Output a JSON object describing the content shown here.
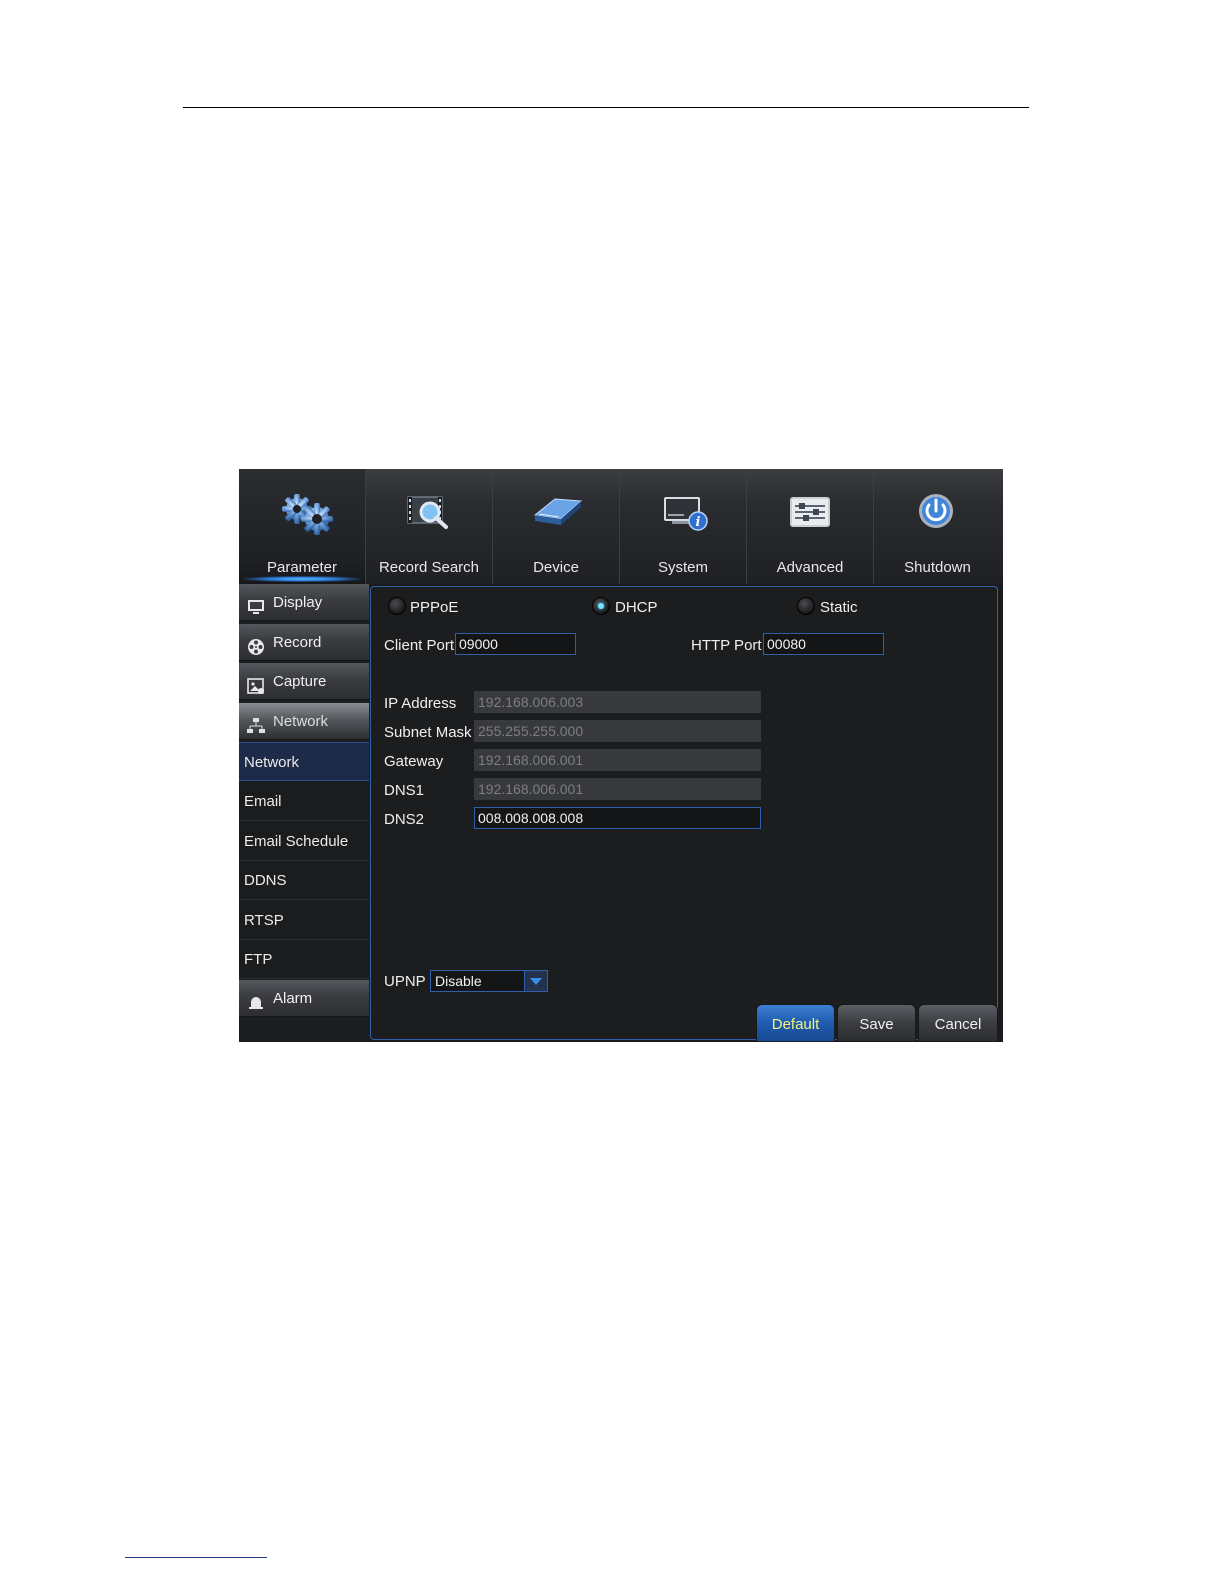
{
  "tabs": [
    {
      "label": "Parameter",
      "icon": "gears-icon"
    },
    {
      "label": "Record Search",
      "icon": "film-search-icon"
    },
    {
      "label": "Device",
      "icon": "hard-drive-icon"
    },
    {
      "label": "System",
      "icon": "monitor-info-icon"
    },
    {
      "label": "Advanced",
      "icon": "sliders-icon"
    },
    {
      "label": "Shutdown",
      "icon": "power-icon"
    }
  ],
  "sidebar": {
    "display": "Display",
    "record": "Record",
    "capture": "Capture",
    "network": "Network",
    "sub_items": [
      "Network",
      "Email",
      "Email Schedule",
      "DDNS",
      "RTSP",
      "FTP"
    ],
    "alarm": "Alarm"
  },
  "mode": {
    "pppoe": "PPPoE",
    "dhcp": "DHCP",
    "static": "Static",
    "selected": "DHCP"
  },
  "ports": {
    "client_port_label": "Client Port",
    "client_port_value": "09000",
    "http_port_label": "HTTP Port",
    "http_port_value": "00080"
  },
  "network": {
    "ip_label": "IP Address",
    "ip_value": "192.168.006.003",
    "subnet_label": "Subnet Mask",
    "subnet_value": "255.255.255.000",
    "gateway_label": "Gateway",
    "gateway_value": "192.168.006.001",
    "dns1_label": "DNS1",
    "dns1_value": "192.168.006.001",
    "dns2_label": "DNS2",
    "dns2_value": "008.008.008.008"
  },
  "upnp": {
    "label": "UPNP",
    "value": "Disable"
  },
  "buttons": {
    "default": "Default",
    "save": "Save",
    "cancel": "Cancel"
  },
  "colors": {
    "accent": "#2f5fa8",
    "default_button_text": "#f5f57a",
    "radio_active": "#6fe3ff"
  }
}
